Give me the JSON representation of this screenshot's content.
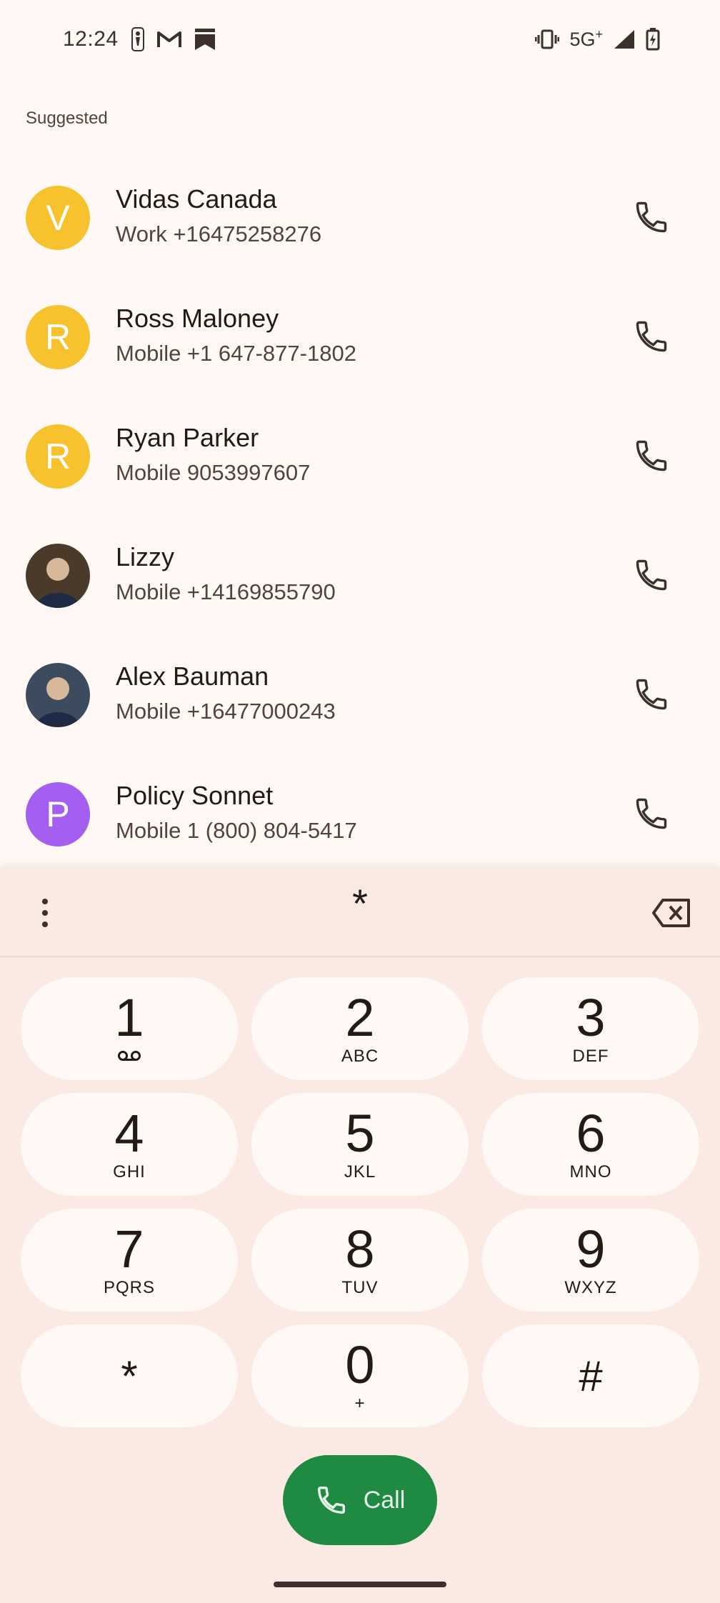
{
  "status_bar": {
    "time": "12:24",
    "left_icons": [
      "nba-icon",
      "gmail-icon",
      "bookmark-icon"
    ],
    "network": "5G",
    "network_sup": "+",
    "right_icons": [
      "vibrate-icon",
      "signal-icon",
      "battery-charging-icon"
    ]
  },
  "suggested": {
    "title": "Suggested",
    "contacts": [
      {
        "name": "Vidas Canada",
        "detail": "Work +16475258276",
        "initial": "V",
        "avatar_color": "#f7c22e"
      },
      {
        "name": "Ross Maloney",
        "detail": "Mobile +1 647-877-1802",
        "initial": "R",
        "avatar_color": "#f7c22e"
      },
      {
        "name": "Ryan Parker",
        "detail": "Mobile 9053997607",
        "initial": "R",
        "avatar_color": "#f7c22e"
      },
      {
        "name": "Lizzy",
        "detail": "Mobile +14169855790",
        "initial": "",
        "avatar_color": "#4a3a2a"
      },
      {
        "name": "Alex Bauman",
        "detail": "Mobile +16477000243",
        "initial": "",
        "avatar_color": "#3d4b5e"
      },
      {
        "name": "Policy Sonnet",
        "detail": "Mobile 1 (800) 804-5417",
        "initial": "P",
        "avatar_color": "#a55ff0"
      }
    ]
  },
  "dialpad": {
    "entered": "*",
    "keys": [
      {
        "digit": "1",
        "letters": "voicemail"
      },
      {
        "digit": "2",
        "letters": "ABC"
      },
      {
        "digit": "3",
        "letters": "DEF"
      },
      {
        "digit": "4",
        "letters": "GHI"
      },
      {
        "digit": "5",
        "letters": "JKL"
      },
      {
        "digit": "6",
        "letters": "MNO"
      },
      {
        "digit": "7",
        "letters": "PQRS"
      },
      {
        "digit": "8",
        "letters": "TUV"
      },
      {
        "digit": "9",
        "letters": "WXYZ"
      },
      {
        "digit": "*",
        "letters": ""
      },
      {
        "digit": "0",
        "letters": "+"
      },
      {
        "digit": "#",
        "letters": ""
      }
    ],
    "call_label": "Call"
  },
  "colors": {
    "accent_green": "#1e8a42",
    "sheet_bg": "#fbeae4",
    "page_bg": "#fff8f5"
  }
}
